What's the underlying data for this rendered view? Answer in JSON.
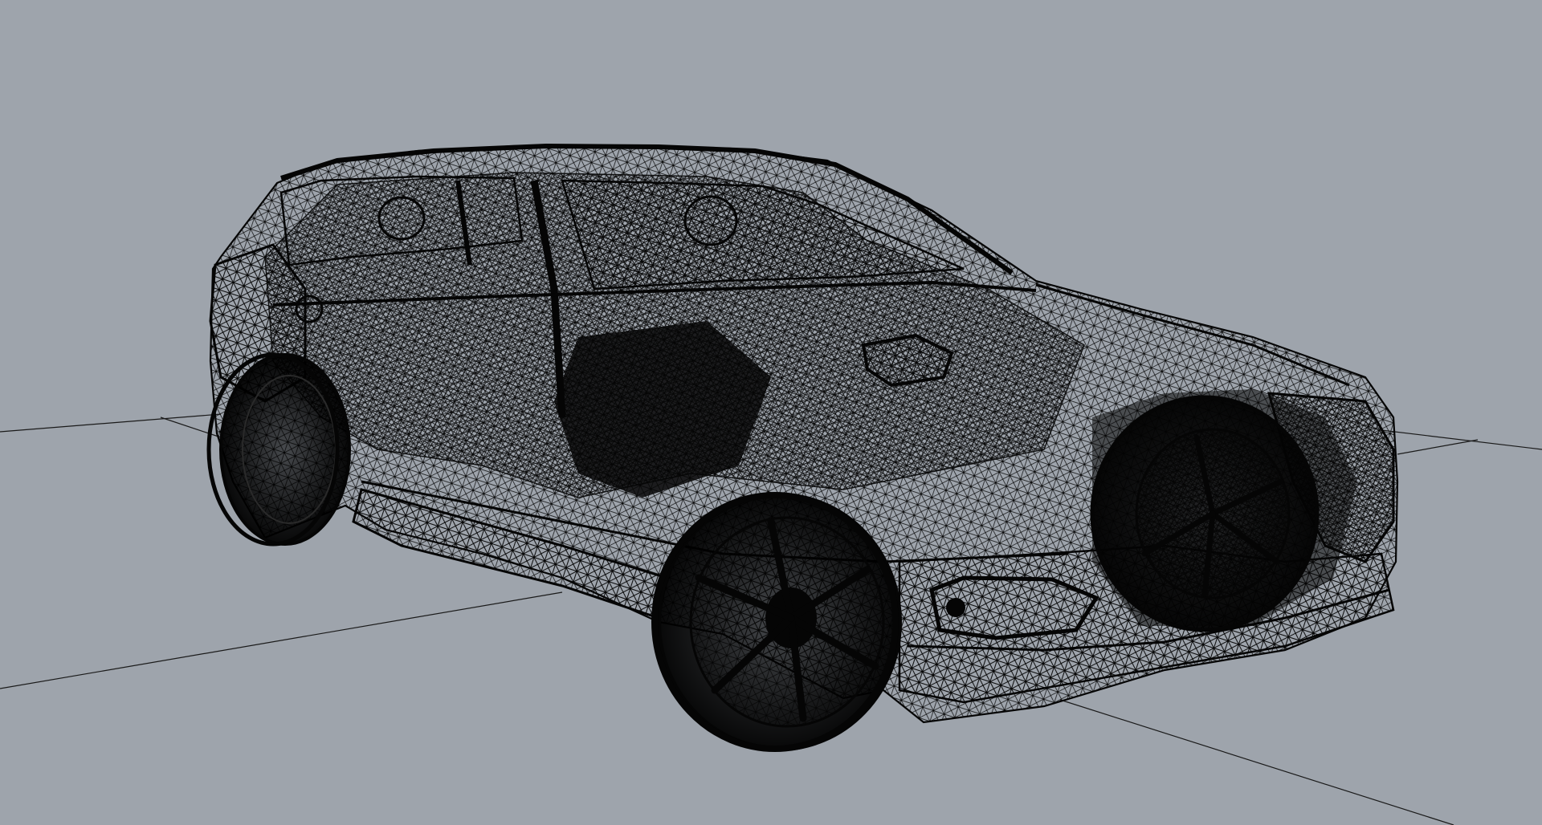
{
  "viewport": {
    "background_color": "#9ea4ac",
    "wireframe_color": "#050505",
    "grid_color": "#1a1a1a",
    "display_mode": "wireframe",
    "object": "car-model-wireframe"
  }
}
